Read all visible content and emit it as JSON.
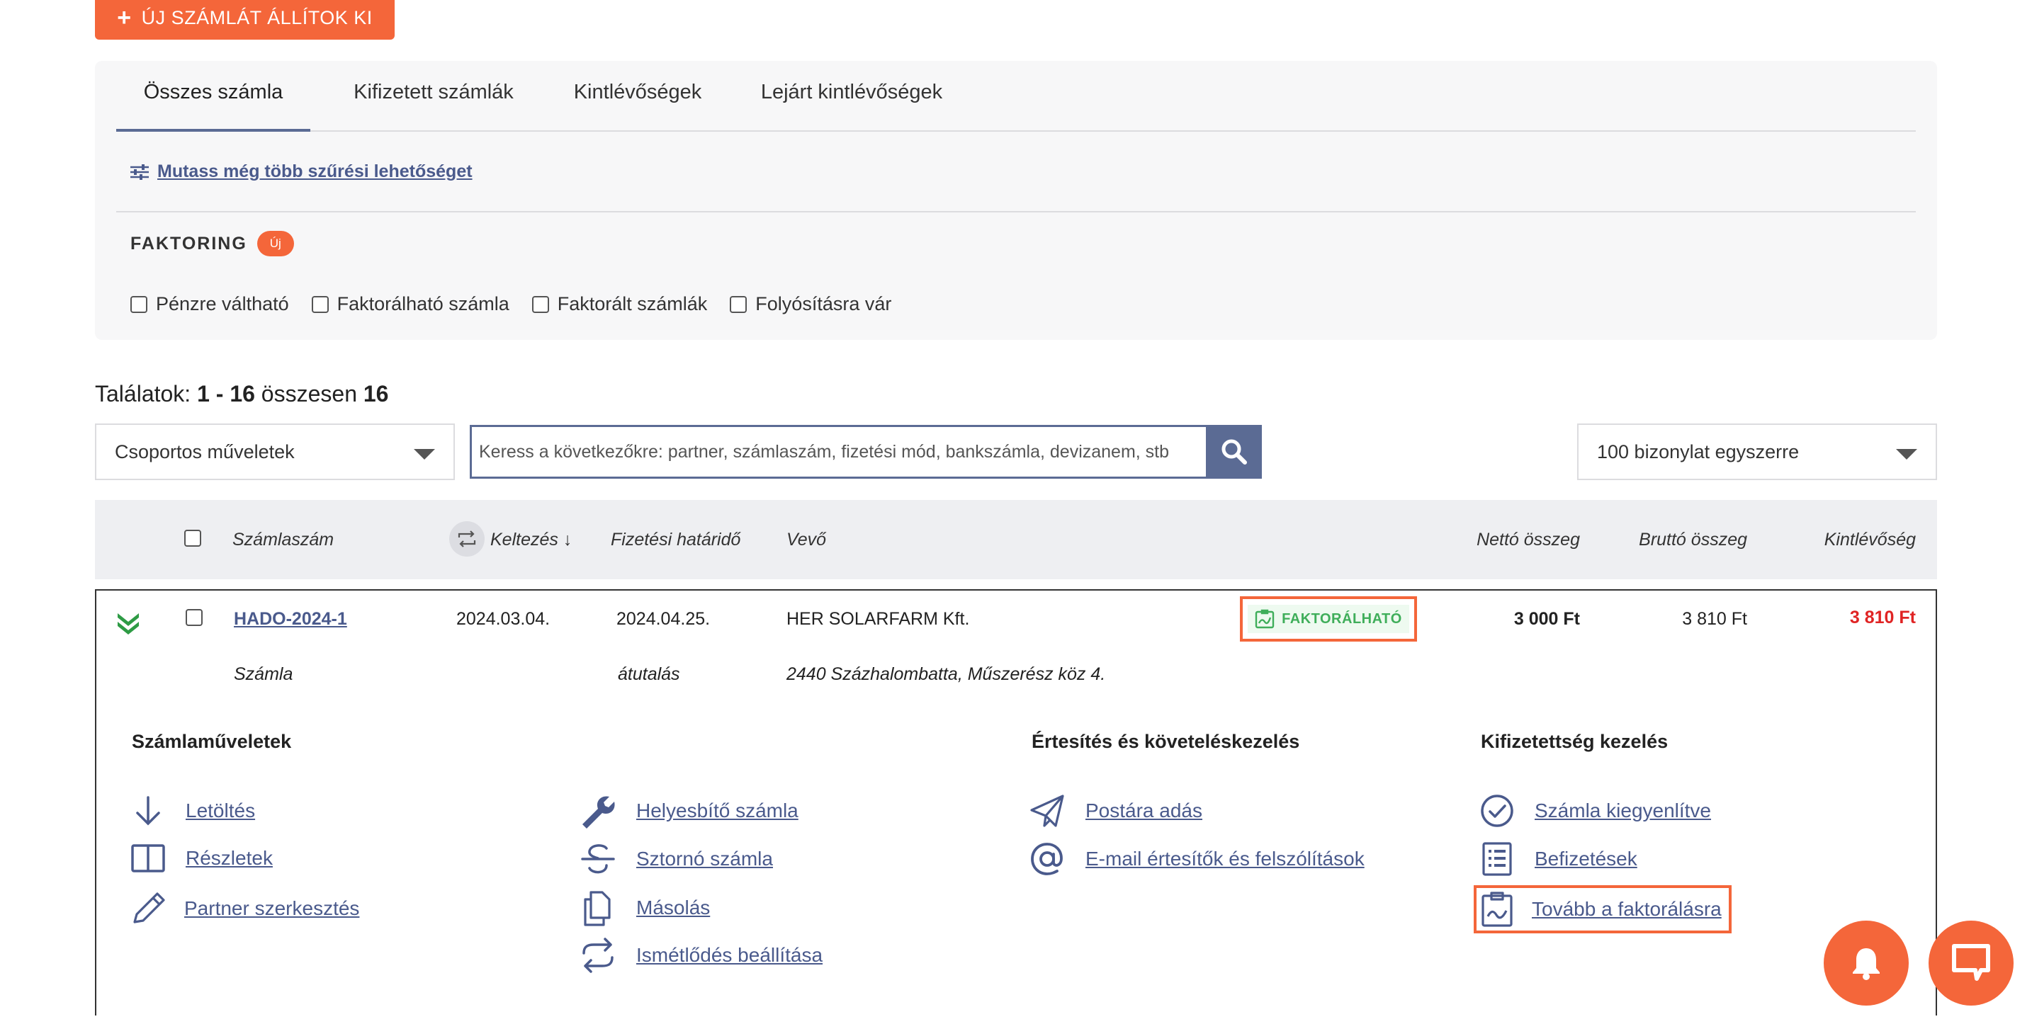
{
  "header": {
    "new_invoice_label": "ÚJ SZÁMLÁT ÁLLÍTOK KI"
  },
  "tabs": [
    {
      "label": "Összes számla",
      "active": true
    },
    {
      "label": "Kifizetett számlák",
      "active": false
    },
    {
      "label": "Kintlévőségek",
      "active": false
    },
    {
      "label": "Lejárt kintlévőségek",
      "active": false
    }
  ],
  "filters": {
    "more_filters_label": "Mutass még több szűrési lehetőséget",
    "factoring_title": "FAKTORING",
    "new_badge": "Új",
    "checkboxes": [
      "Pénzre váltható",
      "Faktorálható számla",
      "Faktorált számlák",
      "Folyósításra vár"
    ]
  },
  "results": {
    "prefix": "Találatok:",
    "range": "1 - 16",
    "middle": "összesen",
    "total": "16"
  },
  "toolbar": {
    "bulk_actions": "Csoportos műveletek",
    "search_placeholder": "Keress a következőkre: partner, számlaszám, fizetési mód, bankszámla, devizanem, stb",
    "page_size": "100 bizonylat egyszerre"
  },
  "table": {
    "columns": {
      "invoice_no": "Számlaszám",
      "issued": "Keltezés",
      "due": "Fizetési határidő",
      "buyer": "Vevő",
      "net": "Nettó összeg",
      "gross": "Bruttó összeg",
      "outstanding": "Kintlévőség"
    },
    "row": {
      "invoice_no": "HADO-2024-1",
      "issued": "2024.03.04.",
      "due": "2024.04.25.",
      "buyer": "HER SOLARFARM Kft.",
      "badge": "FAKTORÁLHATÓ",
      "net": "3 000 Ft",
      "gross": "3 810 Ft",
      "outstanding": "3 810 Ft",
      "type": "Számla",
      "payment": "átutalás",
      "address": "2440 Százhalombatta, Műszerész köz 4."
    }
  },
  "actions": {
    "invoice_ops_title": "Számlaműveletek",
    "notify_title": "Értesítés és követeléskezelés",
    "payment_title": "Kifizetettség kezelés",
    "download": "Letöltés",
    "details": "Részletek",
    "edit_partner": "Partner szerkesztés",
    "corrective": "Helyesbítő számla",
    "storno": "Sztornó számla",
    "copy": "Másolás",
    "recurrence": "Ismétlődés beállítása",
    "post": "Postára adás",
    "email": "E-mail értesítők és felszólítások",
    "settled": "Számla kiegyenlítve",
    "payments": "Befizetések",
    "factoring": "Tovább a faktorálásra"
  },
  "colors": {
    "accent": "#f4663a",
    "primary": "#5b6b94",
    "link": "#4a5a8c",
    "danger": "#e02424",
    "success": "#3fae5a"
  }
}
